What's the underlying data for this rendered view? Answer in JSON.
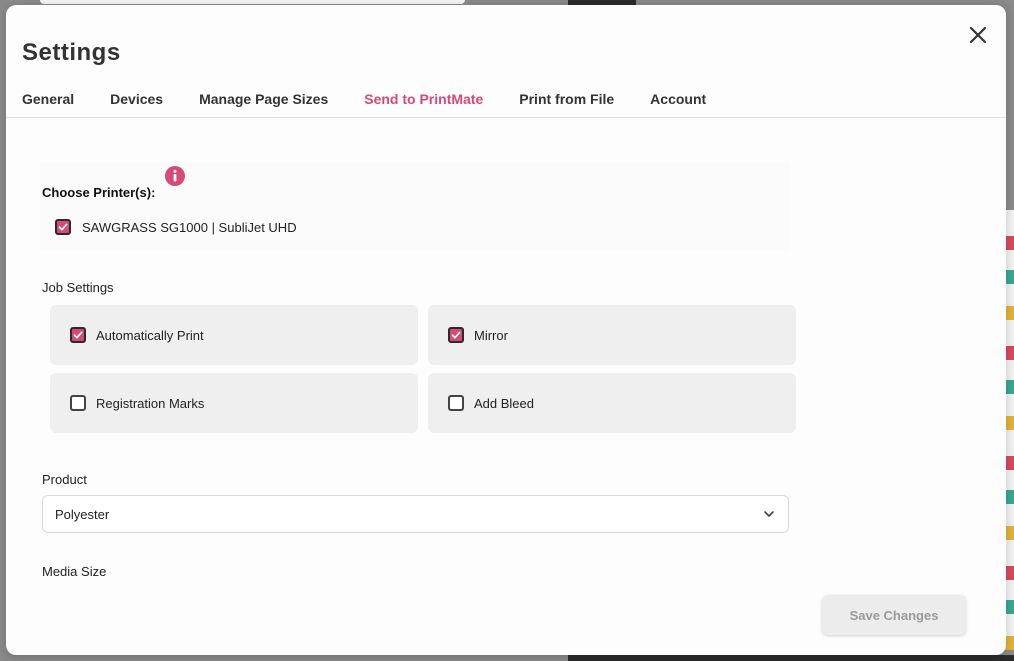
{
  "dialog": {
    "title": "Settings"
  },
  "tabs": [
    {
      "label": "General",
      "active": false
    },
    {
      "label": "Devices",
      "active": false
    },
    {
      "label": "Manage Page Sizes",
      "active": false
    },
    {
      "label": "Send to PrintMate",
      "active": true
    },
    {
      "label": "Print from File",
      "active": false
    },
    {
      "label": "Account",
      "active": false
    }
  ],
  "printers": {
    "label": "Choose Printer(s):",
    "info_icon": "info-icon",
    "items": [
      {
        "name": "SAWGRASS SG1000 | SubliJet UHD",
        "checked": true
      }
    ]
  },
  "job_settings": {
    "label": "Job Settings",
    "options": [
      {
        "label": "Automatically Print",
        "checked": true
      },
      {
        "label": "Mirror",
        "checked": true
      },
      {
        "label": "Registration Marks",
        "checked": false
      },
      {
        "label": "Add Bleed",
        "checked": false
      }
    ]
  },
  "product": {
    "label": "Product",
    "value": "Polyester"
  },
  "media_size": {
    "label": "Media Size"
  },
  "footer": {
    "save_label": "Save Changes"
  },
  "colors": {
    "accent": "#d7497a",
    "tab_active": "#d7497a",
    "panel_bg": "#efefef"
  }
}
